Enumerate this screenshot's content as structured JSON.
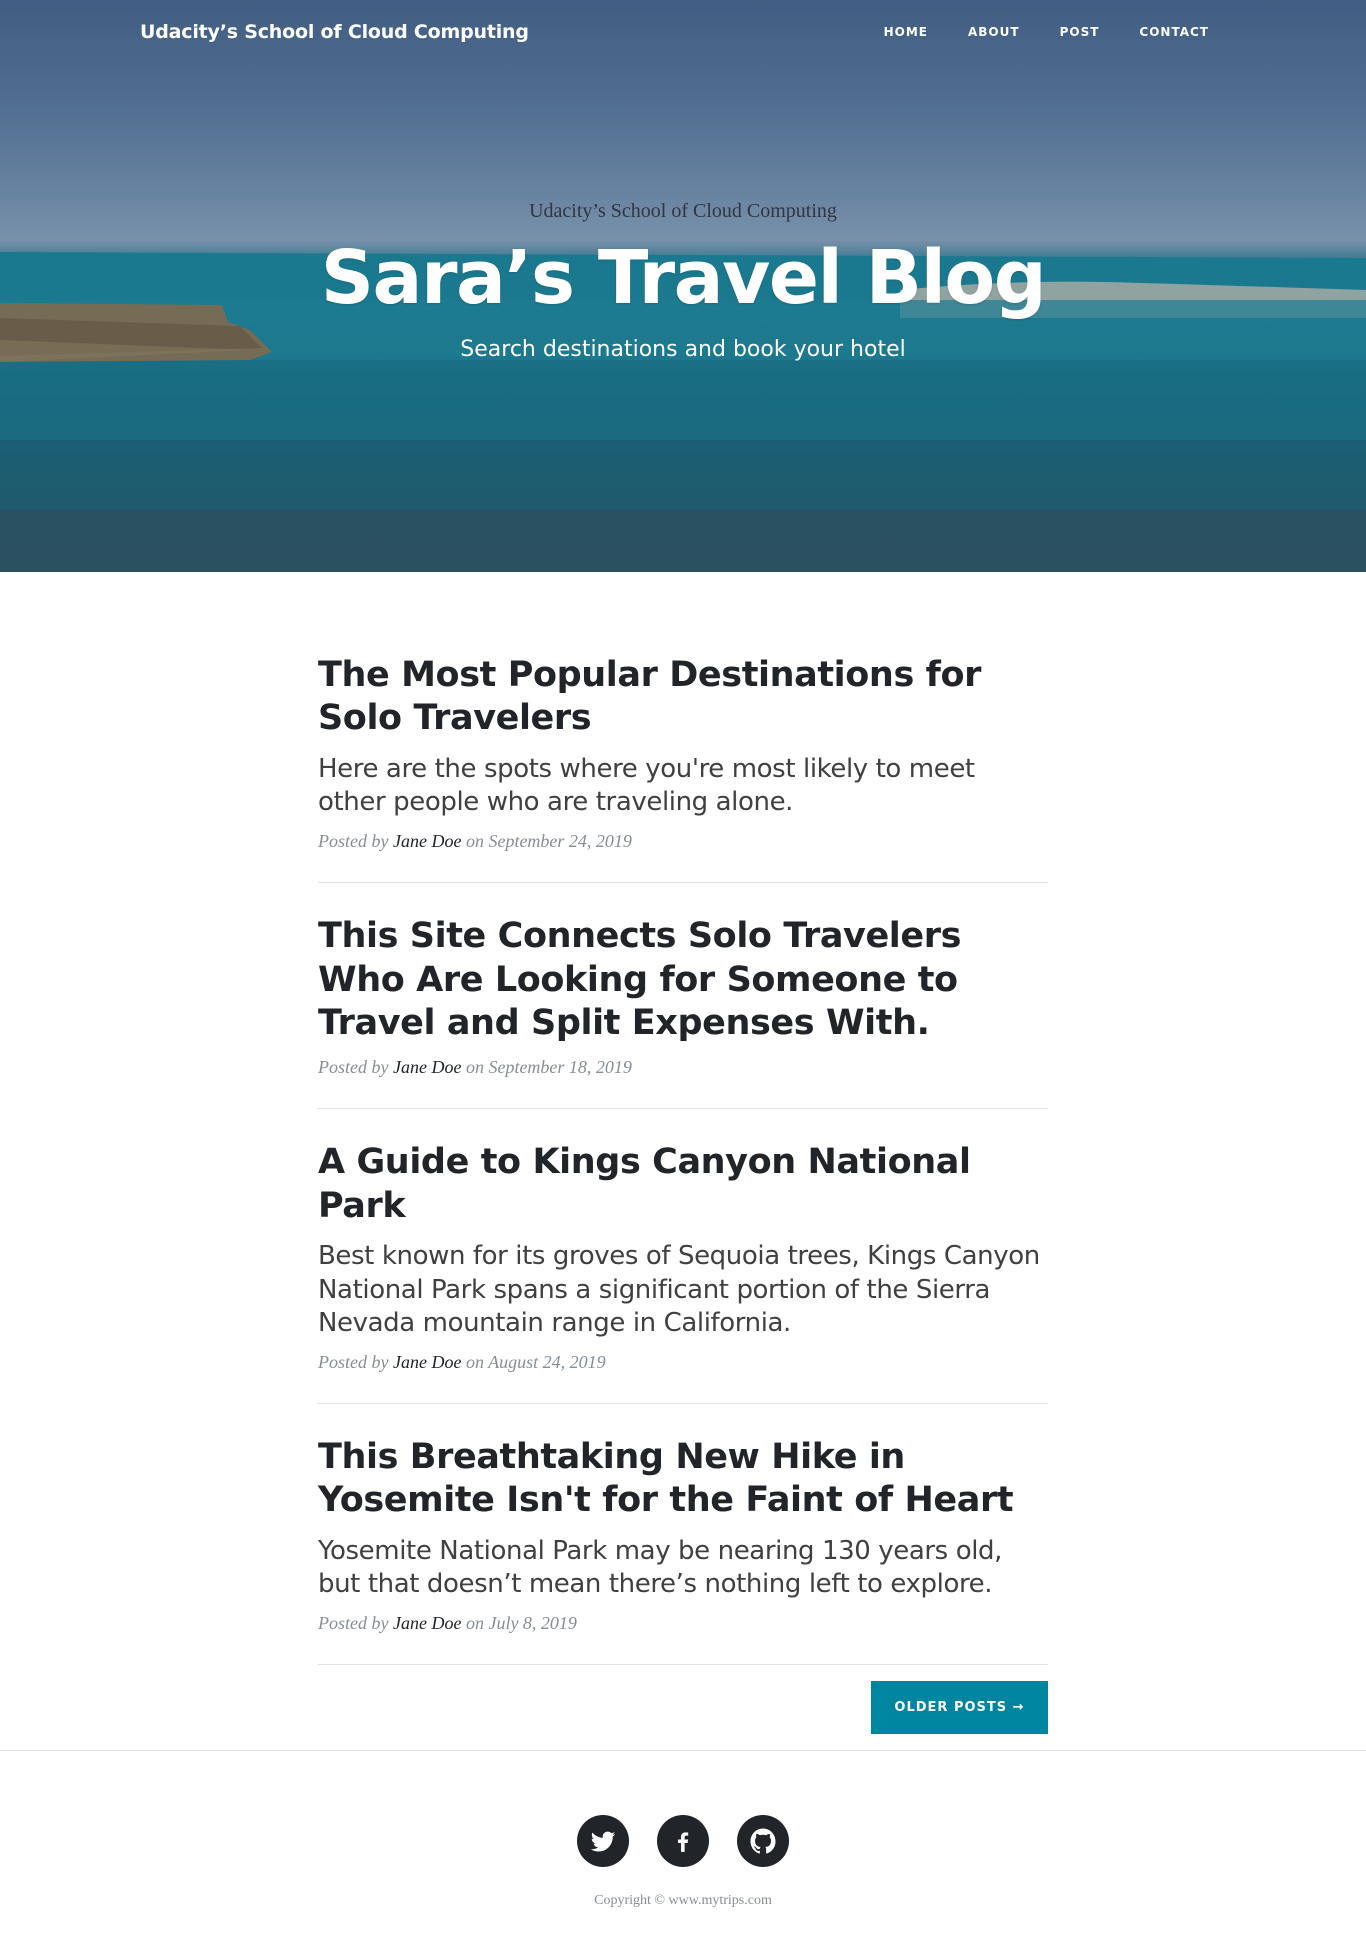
{
  "navbar": {
    "brand": "Udacity’s School of Cloud Computing",
    "links": [
      {
        "label": "HOME"
      },
      {
        "label": "ABOUT"
      },
      {
        "label": "POST"
      },
      {
        "label": "CONTACT"
      }
    ]
  },
  "hero": {
    "kicker": "Udacity’s School of Cloud Computing",
    "title": "Sara’s Travel Blog",
    "subtitle": "Search destinations and book your hotel"
  },
  "posts": [
    {
      "title": "The Most Popular Destinations for Solo Travelers",
      "subtitle": "Here are the spots where you're most likely to meet other people who are traveling alone.",
      "posted_by": "Posted by",
      "author": "Jane Doe",
      "on": "on",
      "date": "September 24, 2019"
    },
    {
      "title": "This Site Connects Solo Travelers Who Are Looking for Someone to Travel and Split Expenses With.",
      "posted_by": "Posted by",
      "author": "Jane Doe",
      "on": "on",
      "date": "September 18, 2019"
    },
    {
      "title": "A Guide to Kings Canyon National Park",
      "subtitle": "Best known for its groves of Sequoia trees, Kings Canyon National Park spans a significant portion of the Sierra Nevada mountain range in California.",
      "posted_by": "Posted by",
      "author": "Jane Doe",
      "on": "on",
      "date": "August 24, 2019"
    },
    {
      "title": "This Breathtaking New Hike in Yosemite Isn't for the Faint of Heart",
      "subtitle": "Yosemite National Park may be nearing 130 years old, but that doesn’t mean there’s nothing left to explore.",
      "posted_by": "Posted by",
      "author": "Jane Doe",
      "on": "on",
      "date": "July 8, 2019"
    }
  ],
  "pager": {
    "older_label": "OLDER POSTS →"
  },
  "footer": {
    "social": [
      {
        "icon": "twitter-icon"
      },
      {
        "icon": "facebook-icon"
      },
      {
        "icon": "github-icon"
      }
    ],
    "copyright": "Copyright © www.mytrips.com"
  },
  "colors": {
    "accent": "#0085a1",
    "text": "#212529",
    "muted": "#868e96"
  }
}
